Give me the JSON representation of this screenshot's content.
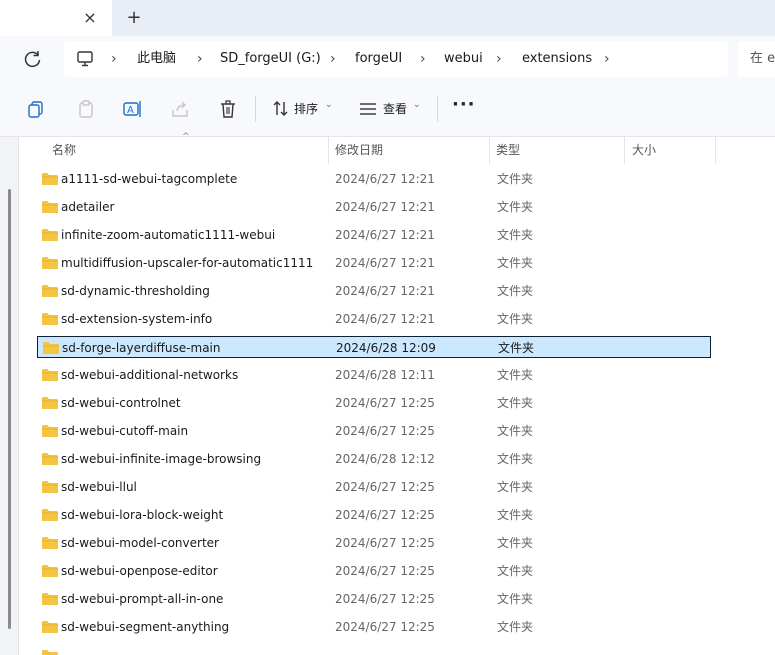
{
  "tabbar": {
    "close_glyph": "×",
    "new_glyph": "+"
  },
  "address": {
    "crumbs": [
      "此电脑",
      "SD_forgeUI (G:)",
      "forgeUI",
      "webui",
      "extensions"
    ],
    "search_placeholder": "在 e"
  },
  "commandbar": {
    "sort_label": "排序",
    "view_label": "查看",
    "more_label": "···"
  },
  "columns": {
    "name": "名称",
    "date": "修改日期",
    "type": "类型",
    "size": "大小"
  },
  "files": [
    {
      "name": "a1111-sd-webui-tagcomplete",
      "date": "2024/6/27 12:21",
      "type": "文件夹"
    },
    {
      "name": "adetailer",
      "date": "2024/6/27 12:21",
      "type": "文件夹"
    },
    {
      "name": "infinite-zoom-automatic1111-webui",
      "date": "2024/6/27 12:21",
      "type": "文件夹"
    },
    {
      "name": "multidiffusion-upscaler-for-automatic1111",
      "date": "2024/6/27 12:21",
      "type": "文件夹"
    },
    {
      "name": "sd-dynamic-thresholding",
      "date": "2024/6/27 12:21",
      "type": "文件夹"
    },
    {
      "name": "sd-extension-system-info",
      "date": "2024/6/27 12:21",
      "type": "文件夹"
    },
    {
      "name": "sd-forge-layerdiffuse-main",
      "date": "2024/6/28 12:09",
      "type": "文件夹",
      "selected": true
    },
    {
      "name": "sd-webui-additional-networks",
      "date": "2024/6/28 12:11",
      "type": "文件夹"
    },
    {
      "name": "sd-webui-controlnet",
      "date": "2024/6/27 12:25",
      "type": "文件夹"
    },
    {
      "name": "sd-webui-cutoff-main",
      "date": "2024/6/27 12:25",
      "type": "文件夹"
    },
    {
      "name": "sd-webui-infinite-image-browsing",
      "date": "2024/6/28 12:12",
      "type": "文件夹"
    },
    {
      "name": "sd-webui-llul",
      "date": "2024/6/27 12:25",
      "type": "文件夹"
    },
    {
      "name": "sd-webui-lora-block-weight",
      "date": "2024/6/27 12:25",
      "type": "文件夹"
    },
    {
      "name": "sd-webui-model-converter",
      "date": "2024/6/27 12:25",
      "type": "文件夹"
    },
    {
      "name": "sd-webui-openpose-editor",
      "date": "2024/6/27 12:25",
      "type": "文件夹"
    },
    {
      "name": "sd-webui-prompt-all-in-one",
      "date": "2024/6/27 12:25",
      "type": "文件夹"
    },
    {
      "name": "sd-webui-segment-anything",
      "date": "2024/6/27 12:25",
      "type": "文件夹"
    }
  ],
  "colors": {
    "selection_bg": "#cce8ff",
    "folder_yellow": "#f4c542"
  }
}
